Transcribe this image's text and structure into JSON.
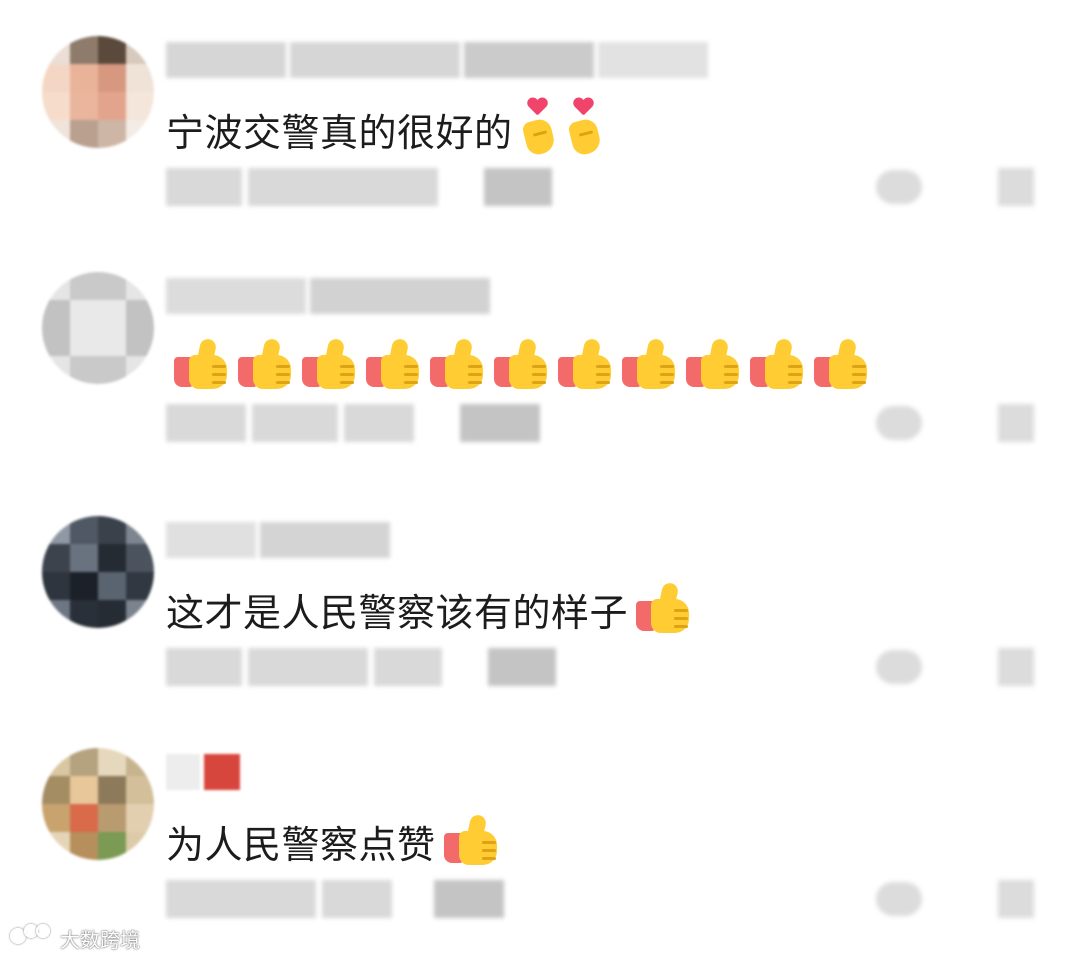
{
  "comments": [
    {
      "text": "宁波交警真的很好的",
      "emoji": "heart-hands",
      "emoji_count": 2
    },
    {
      "text": "",
      "emoji": "thumbs-up",
      "emoji_count": 11
    },
    {
      "text": "这才是人民警察该有的样子",
      "emoji": "thumbs-up",
      "emoji_count": 1
    },
    {
      "text": "为人民警察点赞",
      "emoji": "thumbs-up",
      "emoji_count": 1
    }
  ],
  "watermark": {
    "text": "大数跨境"
  },
  "colors": {
    "thumb_yellow": "#ffcd33",
    "cuff_red": "#f26a6a",
    "heart_pink": "#f0446a",
    "blur_gray": "#d6d6d6"
  }
}
